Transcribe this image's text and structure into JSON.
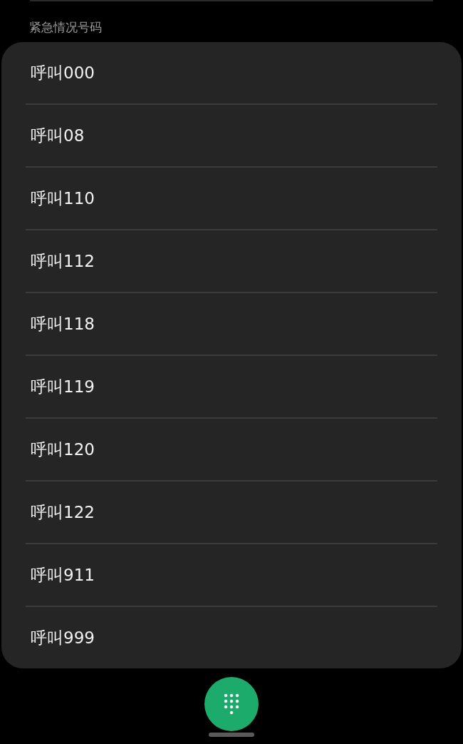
{
  "section_label": "紧急情况号码",
  "items": [
    {
      "label": "呼叫000"
    },
    {
      "label": "呼叫08"
    },
    {
      "label": "呼叫110"
    },
    {
      "label": "呼叫112"
    },
    {
      "label": "呼叫118"
    },
    {
      "label": "呼叫119"
    },
    {
      "label": "呼叫120"
    },
    {
      "label": "呼叫122"
    },
    {
      "label": "呼叫911"
    },
    {
      "label": "呼叫999"
    }
  ]
}
